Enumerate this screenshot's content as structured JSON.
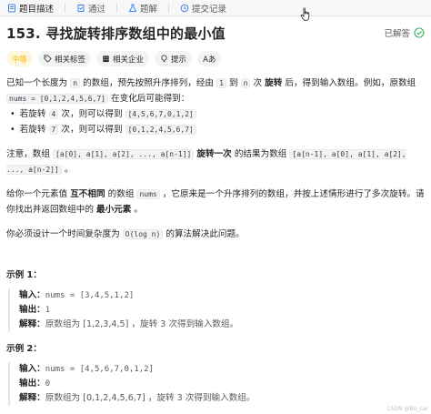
{
  "tabs": [
    {
      "label": "题目描述",
      "icon": "doc-icon"
    },
    {
      "label": "通过",
      "icon": "check-icon"
    },
    {
      "label": "题解",
      "icon": "flask-icon"
    },
    {
      "label": "提交记录",
      "icon": "history-icon"
    }
  ],
  "problem": {
    "title": "153. 寻找旋转排序数组中的最小值",
    "status": "已解答"
  },
  "tags": [
    {
      "label": "中等",
      "icon": ""
    },
    {
      "label": "相关标签",
      "icon": "tag-icon"
    },
    {
      "label": "相关企业",
      "icon": "building-icon"
    },
    {
      "label": "提示",
      "icon": "bulb-icon"
    },
    {
      "label": "Aあ",
      "icon": "translate-icon"
    }
  ],
  "desc": {
    "p1a": "已知一个长度为 ",
    "n": "n",
    "p1b": " 的数组，预先按照升序排列，经由 ",
    "one": "1",
    "p1c": " 到 ",
    "p1d": " 次 ",
    "rotate": "旋转",
    "p1e": " 后，得到输入数组。例如，原数组 ",
    "nums_orig": "nums = [0,1,2,4,5,6,7]",
    "p1f": " 在变化后可能得到：",
    "bullet1a": "若旋转 ",
    "four": "4",
    "bullet1b": " 次，则可以得到 ",
    "arr1": "[4,5,6,7,0,1,2]",
    "bullet2a": "若旋转 ",
    "seven": "7",
    "bullet2b": " 次，则可以得到 ",
    "arr2": "[0,1,2,4,5,6,7]",
    "p2a": "注意，数组 ",
    "arr_a": "[a[0], a[1], a[2], ..., a[n-1]]",
    "p2b": " ",
    "rotate_once": "旋转一次",
    "p2c": " 的结果为数组 ",
    "arr_b": "[a[n-1], a[0], a[1], a[2], ..., a[n-2]]",
    "p2d": " 。",
    "p3a": "给你一个元素值 ",
    "distinct": "互不相同",
    "p3b": " 的数组 ",
    "nums": "nums",
    "p3c": " ，它原来是一个升序排列的数组，并按上述情形进行了多次旋转。请你找出并返回数组中的 ",
    "min_elem": "最小元素",
    "p3d": " 。",
    "p4a": "你必须设计一个时间复杂度为 ",
    "ologn": "O(log n)",
    "p4b": " 的算法解决此问题。"
  },
  "examples": [
    {
      "title": "示例 1：",
      "input_label": "输入：",
      "input": "nums = [3,4,5,1,2]",
      "output_label": "输出：",
      "output": "1",
      "explain_label": "解释：",
      "explain_a": "原数组为 [1,2,3,4,5] ，旋转 3 次得到输入数组。"
    },
    {
      "title": "示例 2：",
      "input_label": "输入：",
      "input": "nums = [4,5,6,7,0,1,2]",
      "output_label": "输出：",
      "output": "0",
      "explain_label": "解释：",
      "explain_a": "原数组为 [0,1,2,4,5,6,7] ，旋转 3 次得到输入数组。"
    }
  ],
  "watermark": "CSDN @Bo_cai"
}
